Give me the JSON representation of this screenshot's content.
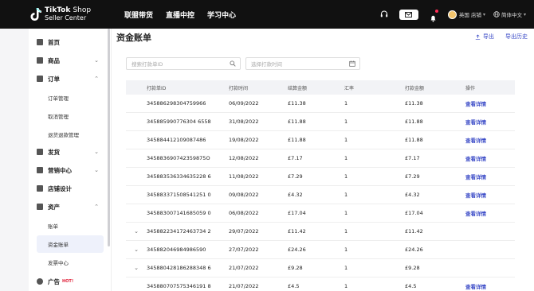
{
  "topbar": {
    "logo_line1": "TikTok",
    "logo_line1_suffix": "Shop",
    "logo_line2": "Seller Center",
    "nav": [
      "联盟带货",
      "直播中控",
      "学习中心"
    ],
    "store_label": "英国 店铺",
    "language_label": "简体中文"
  },
  "sidebar": {
    "items": [
      {
        "label": "首页",
        "icon": "home-icon"
      },
      {
        "label": "商品",
        "icon": "product-icon"
      },
      {
        "label": "订单",
        "icon": "order-icon"
      },
      {
        "label": "发货",
        "icon": "shipping-icon"
      },
      {
        "label": "营销中心",
        "icon": "marketing-icon"
      },
      {
        "label": "店铺设计",
        "icon": "store-design-icon"
      },
      {
        "label": "资产",
        "icon": "assets-icon"
      },
      {
        "label": "广告",
        "icon": "ads-icon",
        "badge": "HOT!"
      }
    ],
    "order_subs": [
      "订单管理",
      "取消管理",
      "退货退款管理"
    ],
    "asset_subs": [
      "账单",
      "资金账单",
      "发票中心"
    ]
  },
  "main": {
    "title": "资金账单",
    "export_label": "导出",
    "export_history_label": "导出历史",
    "search_placeholder": "搜索打款单ID",
    "date_placeholder": "选择打款时间"
  },
  "table": {
    "headers": [
      "打款单ID",
      "打款时间",
      "结算金额",
      "汇率",
      "打款金额",
      "操作"
    ],
    "rows": [
      {
        "expand": "",
        "id": "345886298304759966",
        "time": "06/09/2022",
        "settle": "£11.38",
        "rate": "1",
        "paid": "£11.38",
        "action": "查看详情"
      },
      {
        "expand": "",
        "id": "345885990776304 6558",
        "time": "31/08/2022",
        "settle": "£11.88",
        "rate": "1",
        "paid": "£11.88",
        "action": "查看详情"
      },
      {
        "expand": "",
        "id": "345884412109087486",
        "time": "19/08/2022",
        "settle": "£11.88",
        "rate": "1",
        "paid": "£11.88",
        "action": "查看详情"
      },
      {
        "expand": "",
        "id": "345883690742359875O",
        "time": "12/08/2022",
        "settle": "£7.17",
        "rate": "1",
        "paid": "£7.17",
        "action": "查看详情"
      },
      {
        "expand": "",
        "id": "345883536334635228 6",
        "time": "11/08/2022",
        "settle": "£7.29",
        "rate": "1",
        "paid": "£7.29",
        "action": "查看详情"
      },
      {
        "expand": "",
        "id": "345883371508541251 0",
        "time": "09/08/2022",
        "settle": "£4.32",
        "rate": "1",
        "paid": "£4.32",
        "action": "查看详情"
      },
      {
        "expand": "",
        "id": "345883007141685059 0",
        "time": "06/08/2022",
        "settle": "£17.04",
        "rate": "1",
        "paid": "£17.04",
        "action": "查看详情"
      },
      {
        "expand": "⌄",
        "id": "345882234172463734 2",
        "time": "29/07/2022",
        "settle": "£11.42",
        "rate": "1",
        "paid": "£11.42",
        "action": ""
      },
      {
        "expand": "⌄",
        "id": "345882046984986590",
        "time": "27/07/2022",
        "settle": "£24.26",
        "rate": "1",
        "paid": "£24.26",
        "action": ""
      },
      {
        "expand": "⌄",
        "id": "345880428186288348 6",
        "time": "21/07/2022",
        "settle": "£9.28",
        "rate": "1",
        "paid": "£9.28",
        "action": ""
      },
      {
        "expand": "",
        "id": "345880707575346191 8",
        "time": "21/07/2022",
        "settle": "£4.5",
        "rate": "1",
        "paid": "£4.5",
        "action": "查看详情"
      }
    ]
  },
  "colors": {
    "accent": "#3b4bc7",
    "topbar": "#111111",
    "hot": "#e0223a"
  }
}
